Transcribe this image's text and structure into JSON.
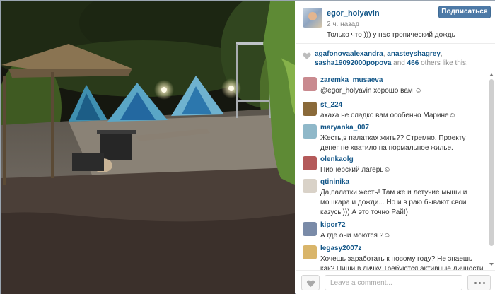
{
  "post": {
    "owner": "egor_holyavin",
    "time": "2 ч. назад",
    "caption": "Только что ))) у нас тропический дождь",
    "follow_label": "Подписаться"
  },
  "likes": {
    "user1": "agafonovaalexandra",
    "sep1": ", ",
    "user2": "anasteyshagrey",
    "sep2": ", ",
    "user3": "sasha19092000popova",
    "and_text": " and ",
    "others_count": "466",
    "tail_text": " others like this."
  },
  "comments": [
    {
      "user": "zaremka_musaeva",
      "text": "@egor_holyavin хорошо вам ☺",
      "avatar_color": "#c98a8f"
    },
    {
      "user": "st_224",
      "text": "ахаха не сладко вам особенно Марине☺",
      "avatar_color": "#8a6a3a"
    },
    {
      "user": "maryanka_007",
      "text": "Жесть,в палатках жить?? Стремно. Проекту денег не хватило на нормальное жилье.",
      "avatar_color": "#8fb8c9"
    },
    {
      "user": "olenkaolg",
      "text": "Пионерский лагерь☺",
      "avatar_color": "#b45a5a"
    },
    {
      "user": "qtininika",
      "text": "Да,палатки жесть! Там же и летучие мыши и мошкара и дожди... Но и в раю бывают свои казусы))) А это точно Рай!)",
      "avatar_color": "#d9d2c8"
    },
    {
      "user": "kipor72",
      "text": "А где они моются ?☺",
      "avatar_color": "#7a8ba8"
    },
    {
      "user": "legasy2007z",
      "text": "Хочешь заработать к новому году? Не знаешь как? Пиши в личку Требуются активные личности для",
      "avatar_color": "#d9b56a"
    }
  ],
  "footer": {
    "comment_placeholder": "Leave a comment..."
  },
  "icons": {
    "likes": "heart-icon",
    "like_button": "heart-outline-icon",
    "more_button": "ellipsis-icon"
  },
  "colors": {
    "link": "#125688",
    "follow_button": "#4d7aa7"
  }
}
